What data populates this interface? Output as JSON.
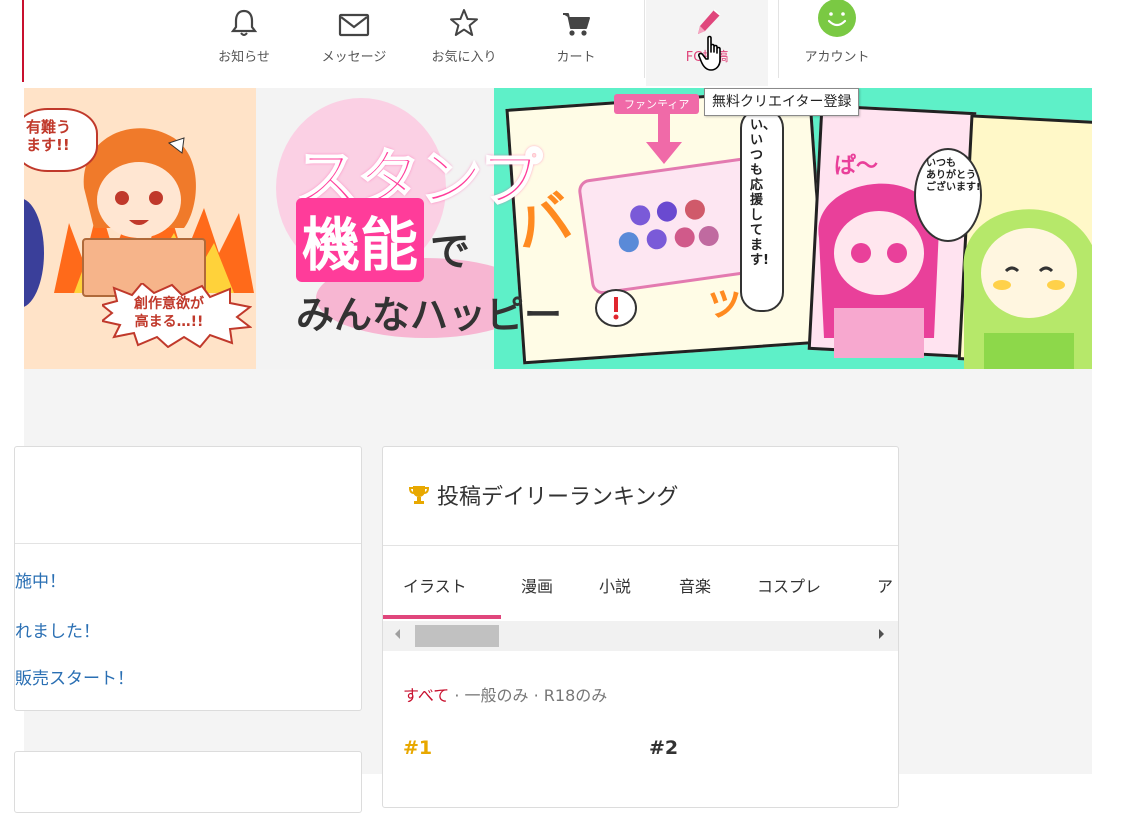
{
  "header": {
    "nav": [
      {
        "label": "お知らせ",
        "icon": "bell-icon"
      },
      {
        "label": "メッセージ",
        "icon": "envelope-icon"
      },
      {
        "label": "お気に入り",
        "icon": "star-icon"
      },
      {
        "label": "カート",
        "icon": "cart-icon"
      },
      {
        "label": "FC投稿",
        "icon": "pencil-icon"
      },
      {
        "label": "アカウント",
        "icon": "smiley-avatar-icon"
      }
    ],
    "tooltip": "無料クリエイター登録"
  },
  "banner": {
    "left_bubble_top": "有難う\nます!!",
    "left_bubble_bottom": "創作意欲が\n高まる…!!",
    "title_line1": "スタンプ",
    "title_line2_a": "機能",
    "title_line2_b": "で",
    "title_line3": "みんなハッピー",
    "tag": "ファンティア",
    "speech_1": "い、いつも応援してます!",
    "speech_2": "いつも\nありがとう\nございます!",
    "sfx": "バ",
    "sfx2": "ぱ〜",
    "sfx3": "ッ"
  },
  "news": {
    "items": [
      "施中！",
      "れました！",
      "販売スタート！"
    ]
  },
  "ranking": {
    "title": "投稿デイリーランキング",
    "tabs": [
      "イラスト",
      "漫画",
      "小説",
      "音楽",
      "コスプレ",
      "ア"
    ],
    "filters": {
      "all": "すべて",
      "sep1": " · ",
      "general": "一般のみ",
      "sep2": " · ",
      "r18": "R18のみ"
    },
    "ranks": [
      "#1",
      "#2"
    ]
  },
  "colors": {
    "accent_pink": "#e0467c",
    "link_blue": "#2a6fb3",
    "rank1_gold": "#e8a800",
    "avatar_green": "#7ac943"
  }
}
